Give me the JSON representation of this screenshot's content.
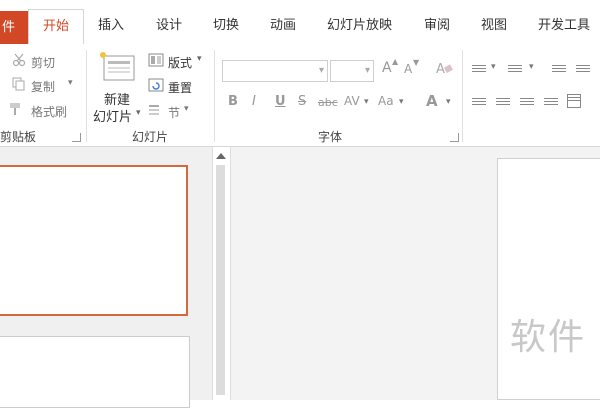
{
  "tabs": {
    "file": "件",
    "home": "开始",
    "insert": "插入",
    "design": "设计",
    "transitions": "切换",
    "animations": "动画",
    "slideshow": "幻灯片放映",
    "review": "审阅",
    "view": "视图",
    "developer": "开发工具"
  },
  "clipboard": {
    "cut": "剪切",
    "copy": "复制",
    "format_painter": "格式刷",
    "group_label": "剪贴板"
  },
  "slides": {
    "new_slide_line1": "新建",
    "new_slide_line2": "幻灯片",
    "layout": "版式",
    "reset": "重置",
    "section": "节",
    "group_label": "幻灯片"
  },
  "font": {
    "group_label": "字体",
    "bold": "B",
    "italic": "I",
    "underline": "U",
    "strike": "S",
    "shadow": "abc",
    "spacing": "AV",
    "case": "Aa",
    "color": "A",
    "grow": "A",
    "shrink": "A"
  },
  "watermark": "软件",
  "colors": {
    "accent": "#d24726",
    "selection_border": "#d4693f"
  }
}
